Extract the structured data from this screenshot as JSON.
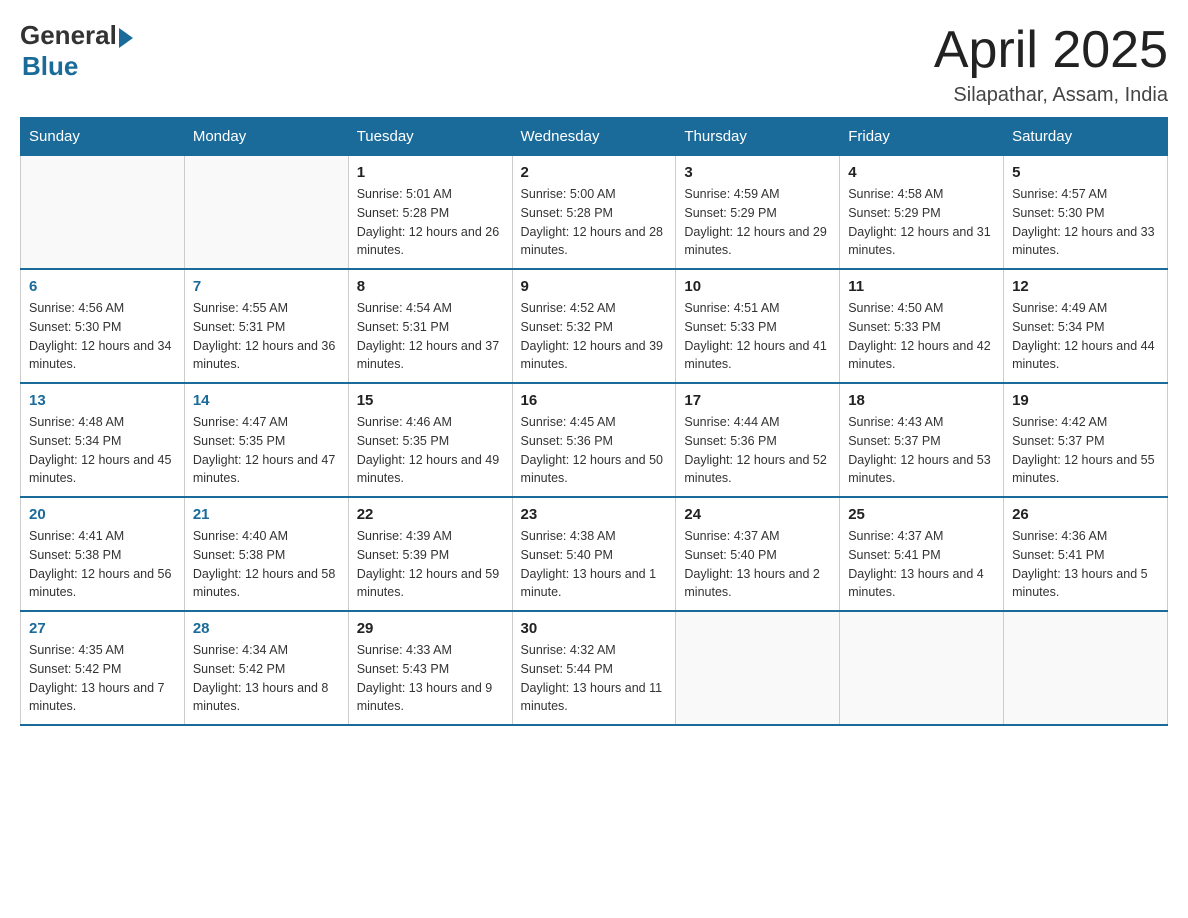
{
  "header": {
    "logo_general": "General",
    "logo_blue": "Blue",
    "month_title": "April 2025",
    "subtitle": "Silapathar, Assam, India"
  },
  "weekdays": [
    "Sunday",
    "Monday",
    "Tuesday",
    "Wednesday",
    "Thursday",
    "Friday",
    "Saturday"
  ],
  "weeks": [
    [
      null,
      null,
      {
        "day": "1",
        "sunrise": "5:01 AM",
        "sunset": "5:28 PM",
        "daylight": "12 hours and 26 minutes."
      },
      {
        "day": "2",
        "sunrise": "5:00 AM",
        "sunset": "5:28 PM",
        "daylight": "12 hours and 28 minutes."
      },
      {
        "day": "3",
        "sunrise": "4:59 AM",
        "sunset": "5:29 PM",
        "daylight": "12 hours and 29 minutes."
      },
      {
        "day": "4",
        "sunrise": "4:58 AM",
        "sunset": "5:29 PM",
        "daylight": "12 hours and 31 minutes."
      },
      {
        "day": "5",
        "sunrise": "4:57 AM",
        "sunset": "5:30 PM",
        "daylight": "12 hours and 33 minutes."
      }
    ],
    [
      {
        "day": "6",
        "sunrise": "4:56 AM",
        "sunset": "5:30 PM",
        "daylight": "12 hours and 34 minutes."
      },
      {
        "day": "7",
        "sunrise": "4:55 AM",
        "sunset": "5:31 PM",
        "daylight": "12 hours and 36 minutes."
      },
      {
        "day": "8",
        "sunrise": "4:54 AM",
        "sunset": "5:31 PM",
        "daylight": "12 hours and 37 minutes."
      },
      {
        "day": "9",
        "sunrise": "4:52 AM",
        "sunset": "5:32 PM",
        "daylight": "12 hours and 39 minutes."
      },
      {
        "day": "10",
        "sunrise": "4:51 AM",
        "sunset": "5:33 PM",
        "daylight": "12 hours and 41 minutes."
      },
      {
        "day": "11",
        "sunrise": "4:50 AM",
        "sunset": "5:33 PM",
        "daylight": "12 hours and 42 minutes."
      },
      {
        "day": "12",
        "sunrise": "4:49 AM",
        "sunset": "5:34 PM",
        "daylight": "12 hours and 44 minutes."
      }
    ],
    [
      {
        "day": "13",
        "sunrise": "4:48 AM",
        "sunset": "5:34 PM",
        "daylight": "12 hours and 45 minutes."
      },
      {
        "day": "14",
        "sunrise": "4:47 AM",
        "sunset": "5:35 PM",
        "daylight": "12 hours and 47 minutes."
      },
      {
        "day": "15",
        "sunrise": "4:46 AM",
        "sunset": "5:35 PM",
        "daylight": "12 hours and 49 minutes."
      },
      {
        "day": "16",
        "sunrise": "4:45 AM",
        "sunset": "5:36 PM",
        "daylight": "12 hours and 50 minutes."
      },
      {
        "day": "17",
        "sunrise": "4:44 AM",
        "sunset": "5:36 PM",
        "daylight": "12 hours and 52 minutes."
      },
      {
        "day": "18",
        "sunrise": "4:43 AM",
        "sunset": "5:37 PM",
        "daylight": "12 hours and 53 minutes."
      },
      {
        "day": "19",
        "sunrise": "4:42 AM",
        "sunset": "5:37 PM",
        "daylight": "12 hours and 55 minutes."
      }
    ],
    [
      {
        "day": "20",
        "sunrise": "4:41 AM",
        "sunset": "5:38 PM",
        "daylight": "12 hours and 56 minutes."
      },
      {
        "day": "21",
        "sunrise": "4:40 AM",
        "sunset": "5:38 PM",
        "daylight": "12 hours and 58 minutes."
      },
      {
        "day": "22",
        "sunrise": "4:39 AM",
        "sunset": "5:39 PM",
        "daylight": "12 hours and 59 minutes."
      },
      {
        "day": "23",
        "sunrise": "4:38 AM",
        "sunset": "5:40 PM",
        "daylight": "13 hours and 1 minute."
      },
      {
        "day": "24",
        "sunrise": "4:37 AM",
        "sunset": "5:40 PM",
        "daylight": "13 hours and 2 minutes."
      },
      {
        "day": "25",
        "sunrise": "4:37 AM",
        "sunset": "5:41 PM",
        "daylight": "13 hours and 4 minutes."
      },
      {
        "day": "26",
        "sunrise": "4:36 AM",
        "sunset": "5:41 PM",
        "daylight": "13 hours and 5 minutes."
      }
    ],
    [
      {
        "day": "27",
        "sunrise": "4:35 AM",
        "sunset": "5:42 PM",
        "daylight": "13 hours and 7 minutes."
      },
      {
        "day": "28",
        "sunrise": "4:34 AM",
        "sunset": "5:42 PM",
        "daylight": "13 hours and 8 minutes."
      },
      {
        "day": "29",
        "sunrise": "4:33 AM",
        "sunset": "5:43 PM",
        "daylight": "13 hours and 9 minutes."
      },
      {
        "day": "30",
        "sunrise": "4:32 AM",
        "sunset": "5:44 PM",
        "daylight": "13 hours and 11 minutes."
      },
      null,
      null,
      null
    ]
  ]
}
